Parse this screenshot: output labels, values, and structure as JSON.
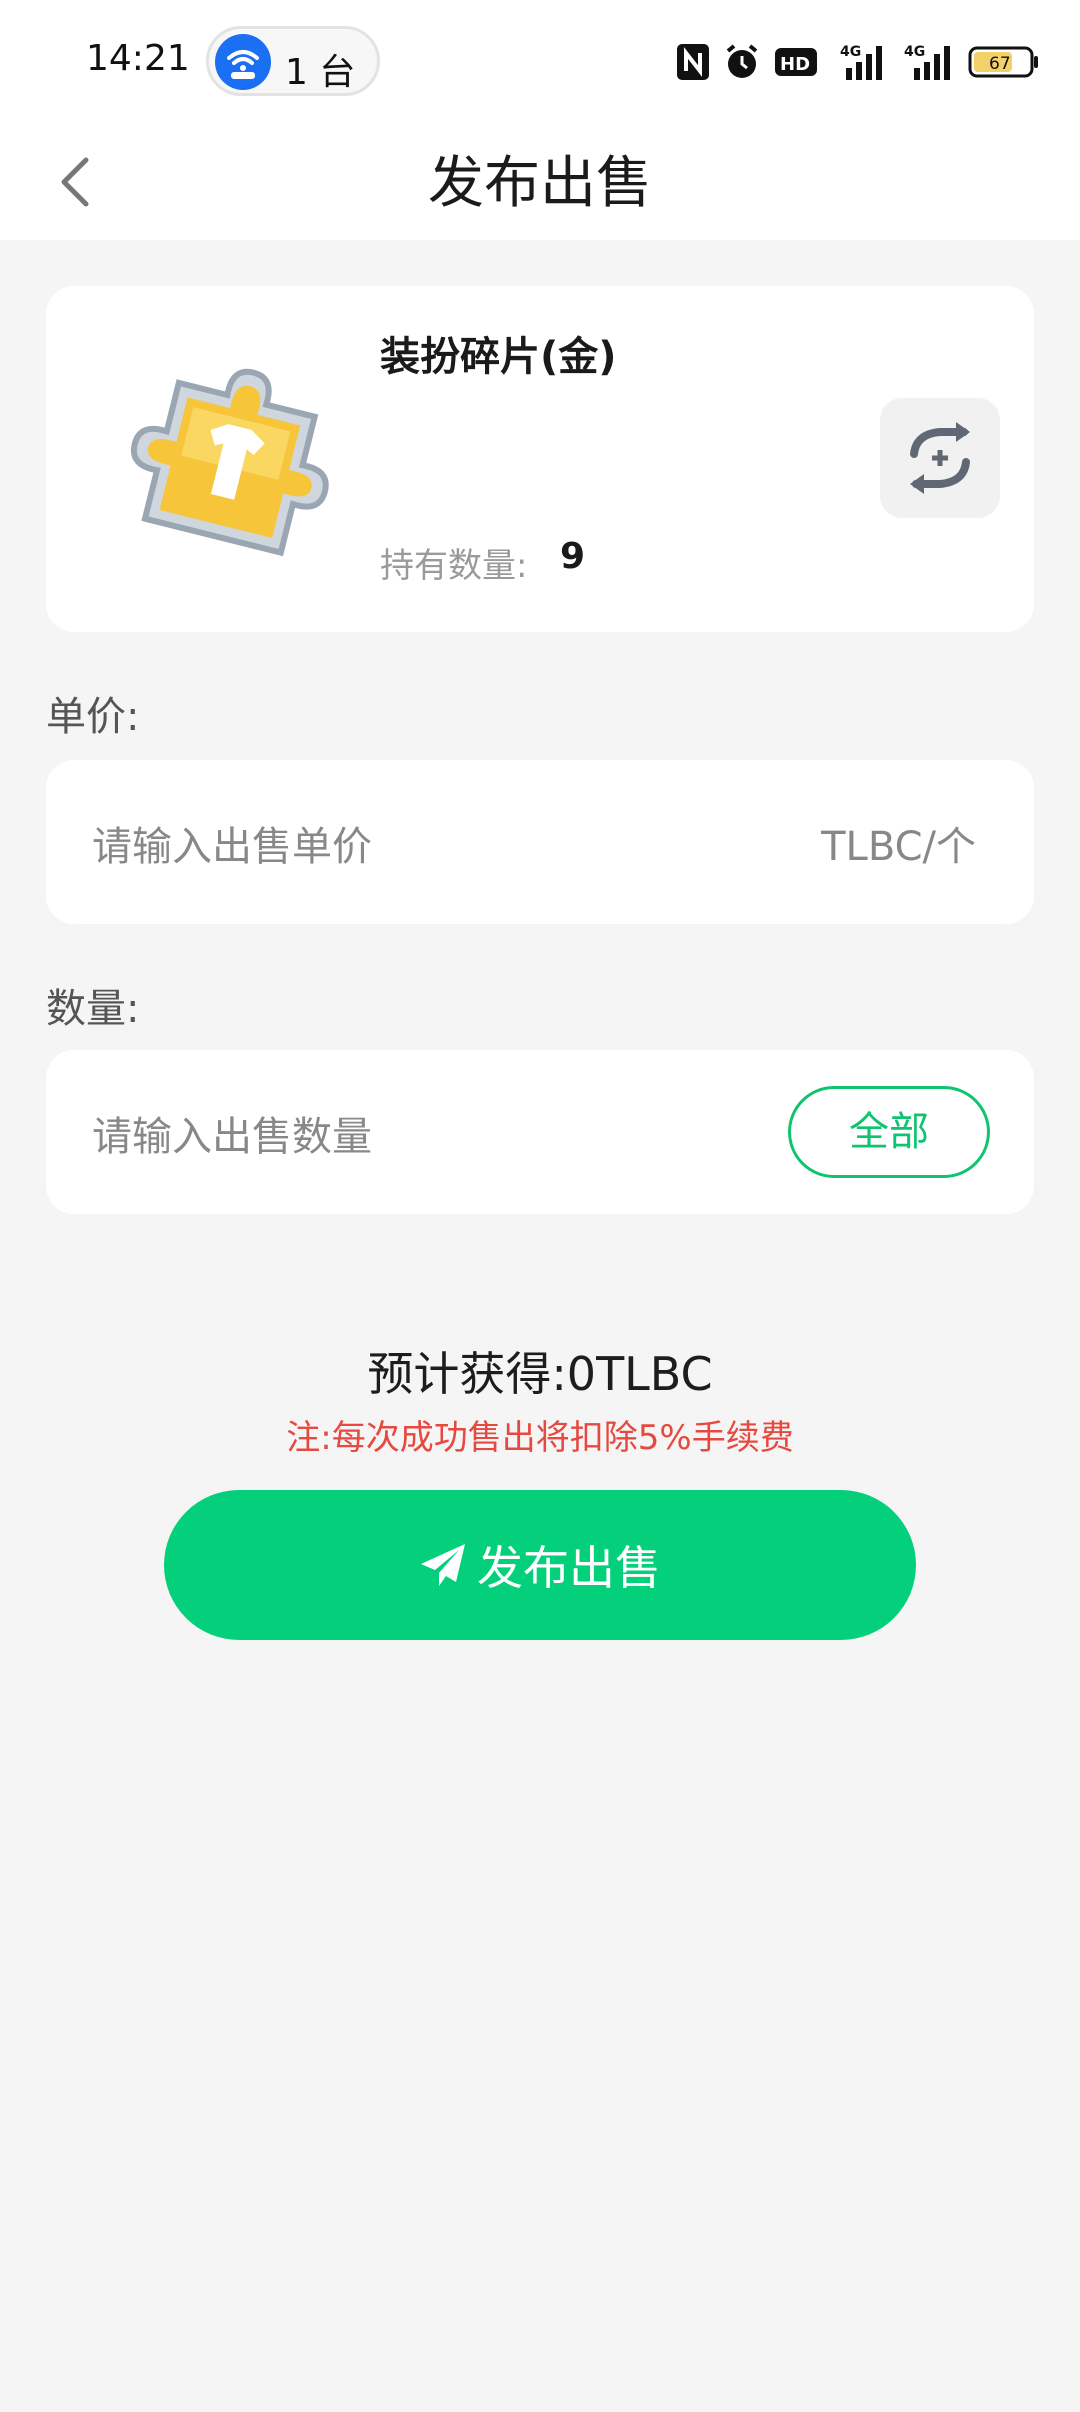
{
  "status_bar": {
    "time": "14:21",
    "hotspot_count": "1 台",
    "battery": "67",
    "icons": [
      "nfc-icon",
      "alarm-icon",
      "hd-icon",
      "signal-4g-icon",
      "signal-4g-icon",
      "battery-icon"
    ]
  },
  "header": {
    "title": "发布出售",
    "back_icon": "chevron-left-icon"
  },
  "item": {
    "name": "装扮碎片(金)",
    "hold_label": "持有数量:",
    "hold_value": "9",
    "image": "gold-puzzle-shirt-icon",
    "switch_icon": "swap-icon"
  },
  "price": {
    "label": "单价:",
    "placeholder": "请输入出售单价",
    "unit": "TLBC/个"
  },
  "quantity": {
    "label": "数量:",
    "placeholder": "请输入出售数量",
    "all_button": "全部"
  },
  "summary": {
    "estimate": "预计获得:0TLBC",
    "notice": "注:每次成功售出将扣除5%手续费"
  },
  "action": {
    "publish_label": "发布出售",
    "icon": "paper-plane-icon"
  },
  "colors": {
    "accent_green": "#04d07c",
    "notice_red": "#e6493f",
    "background": "#f5f5f5"
  }
}
